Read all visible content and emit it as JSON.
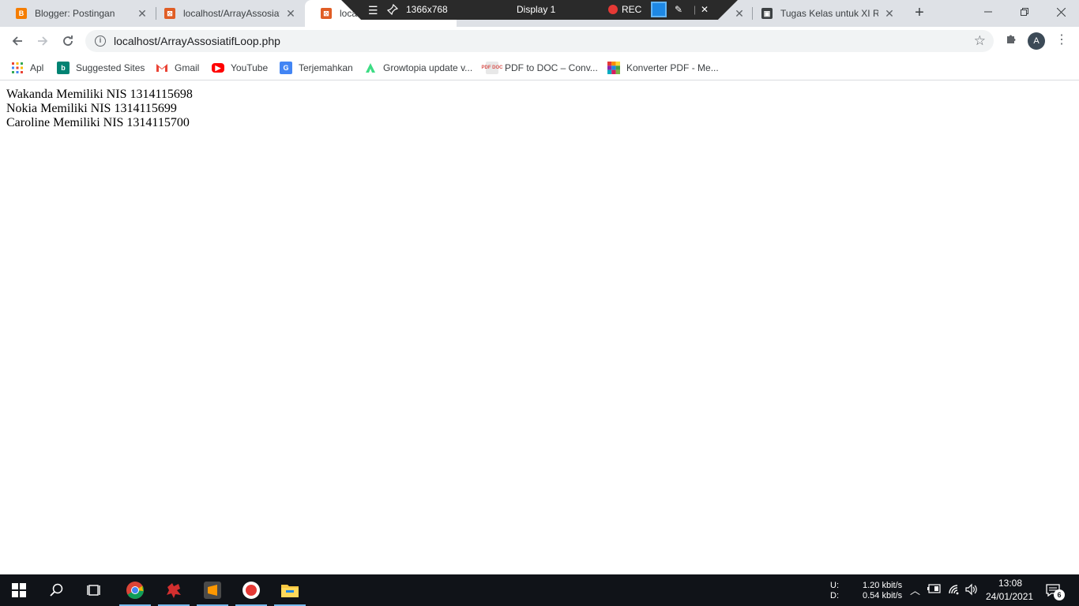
{
  "browser": {
    "tabs": [
      {
        "title": "Blogger: Postingan",
        "icon": "blogger-icon",
        "color": "#f57d00"
      },
      {
        "title": "localhost/ArrayAssosiat",
        "icon": "xampp-icon",
        "color": "#e05d25"
      },
      {
        "title": "local",
        "icon": "xampp-icon",
        "color": "#e05d25",
        "active": true
      },
      {
        "title": "Tugas Kelas untuk XI RP",
        "icon": "classroom-icon",
        "color": "#3c4043"
      }
    ],
    "window_controls": [
      "minimize",
      "restore",
      "close"
    ]
  },
  "recorder": {
    "resolution": "1366x768",
    "display": "Display 1",
    "rec_label": "REC"
  },
  "toolbar": {
    "url": "localhost/ArrayAssosiatifLoop.php",
    "avatar_letter": "A"
  },
  "bookmarks": [
    {
      "label": "Apl",
      "icon": "apps-grid-icon"
    },
    {
      "label": "Suggested Sites",
      "icon": "bing-icon"
    },
    {
      "label": "Gmail",
      "icon": "gmail-icon"
    },
    {
      "label": "YouTube",
      "icon": "youtube-icon"
    },
    {
      "label": "Terjemahkan",
      "icon": "google-translate-icon"
    },
    {
      "label": "Growtopia update v...",
      "icon": "growtopia-icon"
    },
    {
      "label": "PDF to DOC – Conv...",
      "icon": "pdf-doc-icon"
    },
    {
      "label": "Konverter PDF - Me...",
      "icon": "pdf-converter-icon"
    }
  ],
  "page": {
    "lines": [
      "Wakanda Memiliki NIS 1314115698",
      "Nokia Memiliki NIS 1314115699",
      "Caroline Memiliki NIS 1314115700"
    ]
  },
  "taskbar": {
    "apps": [
      "chrome-icon",
      "app-red-icon",
      "sublime-text-icon",
      "screen-recorder-icon",
      "file-explorer-icon"
    ],
    "network": {
      "up_label": "U:",
      "down_label": "D:",
      "up": "1.20 kbit/s",
      "down": "0.54 kbit/s"
    },
    "time": "13:08",
    "date": "24/01/2021",
    "notification_count": "6"
  }
}
